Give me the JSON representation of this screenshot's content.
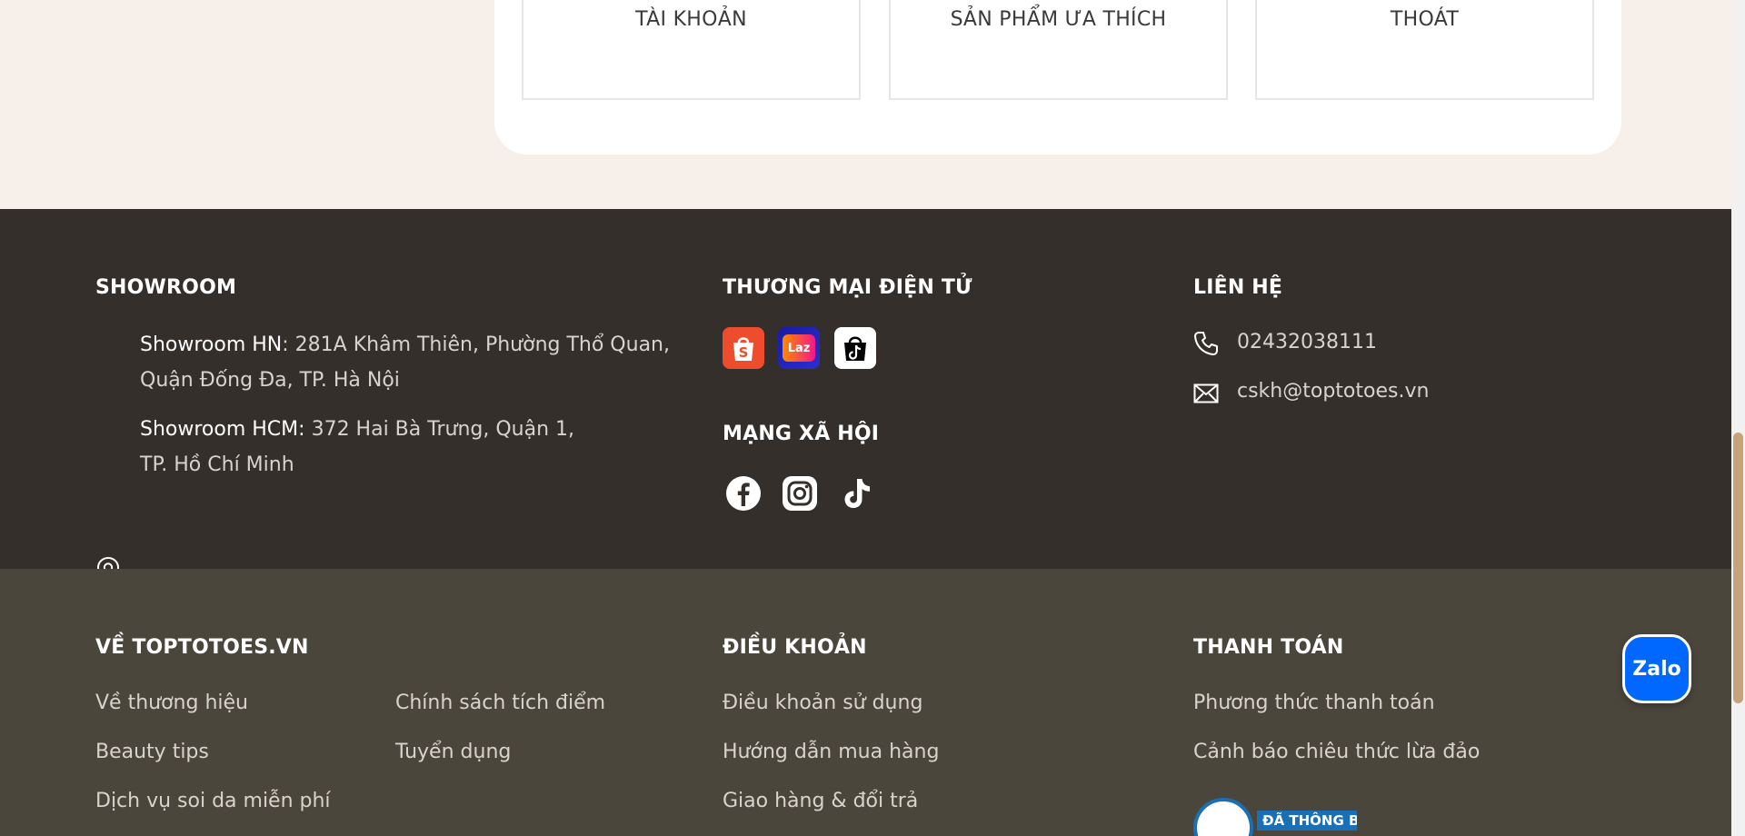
{
  "account_menu": {
    "items": [
      {
        "label": "TÀI KHOẢN"
      },
      {
        "label": "SẢN PHẨM ƯA THÍCH"
      },
      {
        "label": "THOÁT"
      }
    ]
  },
  "showroom": {
    "heading": "SHOWROOM",
    "hn_label": "Showroom HN",
    "hn_address_line1": ": 281A Khâm Thiên, Phường Thổ Quan,",
    "hn_address_line2": "Quận Đống Đa, TP. Hà Nội",
    "hcm_label": "Showroom HCM:",
    "hcm_address_line1": " 372 Hai Bà Trưng, Quận 1,",
    "hcm_address_line2": "TP. Hồ Chí Minh"
  },
  "ecommerce": {
    "heading": "THƯƠNG MẠI ĐIỆN TỬ",
    "stores": [
      "shopee-icon",
      "lazada-icon",
      "tiktok-shop-icon"
    ],
    "lazada_text": "Laz"
  },
  "social": {
    "heading": "MẠNG XÃ HỘI",
    "icons": [
      "facebook-icon",
      "instagram-icon",
      "tiktok-icon"
    ]
  },
  "contact": {
    "heading": "LIÊN HỆ",
    "phone": "02432038111",
    "email": "cskh@toptotoes.vn"
  },
  "about": {
    "heading": "VỀ TOPTOTOES.VN",
    "col1": [
      "Về thương hiệu",
      "Beauty tips",
      "Dịch vụ soi da miễn phí"
    ],
    "col2": [
      "Chính sách tích điểm",
      "Tuyển dụng"
    ]
  },
  "terms": {
    "heading": "ĐIỀU KHOẢN",
    "links": [
      "Điều khoản sử dụng",
      "Hướng dẫn mua hàng",
      "Giao hàng & đổi trả"
    ]
  },
  "payment": {
    "heading": "THANH TOÁN",
    "links": [
      "Phương thức thanh toán",
      "Cảnh báo chiêu thức lừa đảo"
    ],
    "badge_text": "ĐÃ THÔNG BÁO"
  },
  "zalo": {
    "label": "Zalo"
  },
  "colors": {
    "cream_bg": "#f7f0ea",
    "dark_footer": "#342f2a",
    "mid_footer": "#4b463c",
    "zalo_blue": "#0068ff",
    "scroll_thumb": "#c8a27a"
  }
}
